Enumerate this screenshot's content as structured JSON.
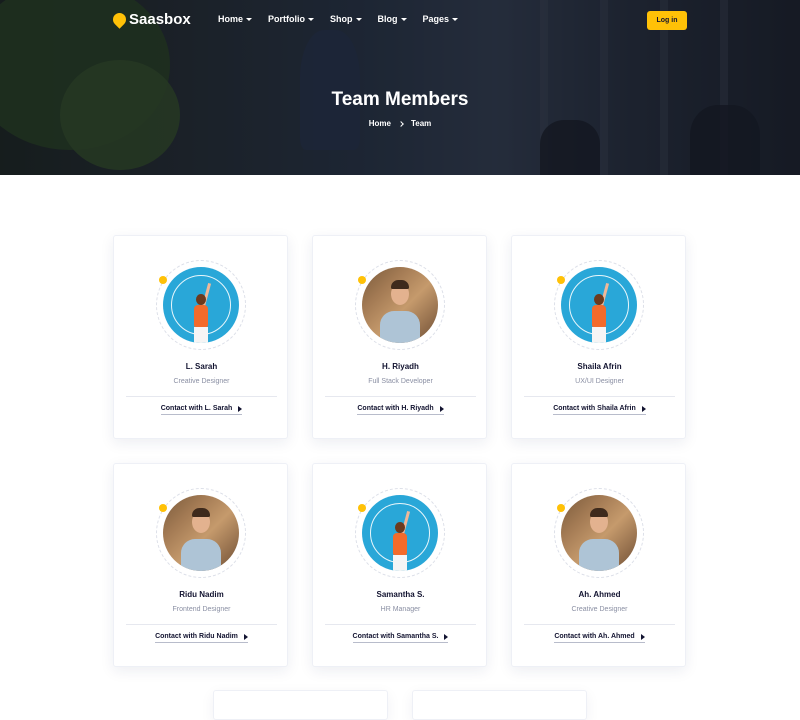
{
  "brand": {
    "name": "Saasbox",
    "accent": "#ffc107",
    "text": "#121330"
  },
  "nav": {
    "items": [
      {
        "label": "Home"
      },
      {
        "label": "Portfolio"
      },
      {
        "label": "Shop"
      },
      {
        "label": "Blog"
      },
      {
        "label": "Pages"
      }
    ],
    "login_label": "Log in"
  },
  "hero": {
    "title": "Team Members",
    "breadcrumb": {
      "home": "Home",
      "current": "Team"
    }
  },
  "team": [
    {
      "name": "L. Sarah",
      "role": "Creative Designer",
      "contact": "Contact with L. Sarah",
      "photo": "woman-blue"
    },
    {
      "name": "H. Riyadh",
      "role": "Full Stack Developer",
      "contact": "Contact with H. Riyadh",
      "photo": "man-cafe"
    },
    {
      "name": "Shaila Afrin",
      "role": "UX/UI Designer",
      "contact": "Contact with Shaila Afrin",
      "photo": "woman-blue"
    },
    {
      "name": "Ridu Nadim",
      "role": "Frontend Designer",
      "contact": "Contact with Ridu Nadim",
      "photo": "man-cafe"
    },
    {
      "name": "Samantha S.",
      "role": "HR Manager",
      "contact": "Contact with Samantha S.",
      "photo": "woman-blue"
    },
    {
      "name": "Ah. Ahmed",
      "role": "Creative Designer",
      "contact": "Contact with Ah. Ahmed",
      "photo": "man-cafe"
    }
  ]
}
